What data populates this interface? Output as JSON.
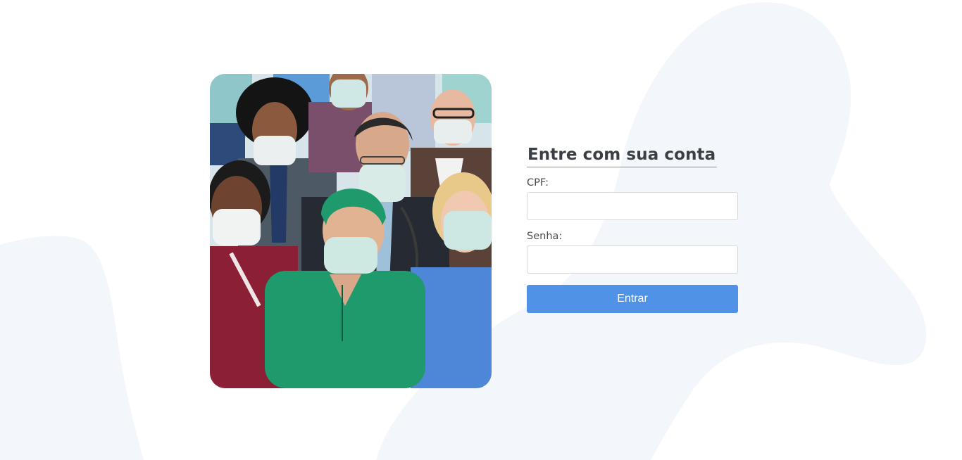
{
  "login": {
    "title": "Entre com sua conta",
    "cpf_label": "CPF:",
    "cpf_value": "",
    "password_label": "Senha:",
    "password_value": "",
    "submit_label": "Entrar"
  },
  "colors": {
    "background": "#ffffff",
    "background_shape": "#f3f6fb",
    "accent": "#5092e6",
    "title_text": "#3b3f45"
  },
  "hero_image": {
    "subject": "group of healthcare workers wearing face masks"
  }
}
